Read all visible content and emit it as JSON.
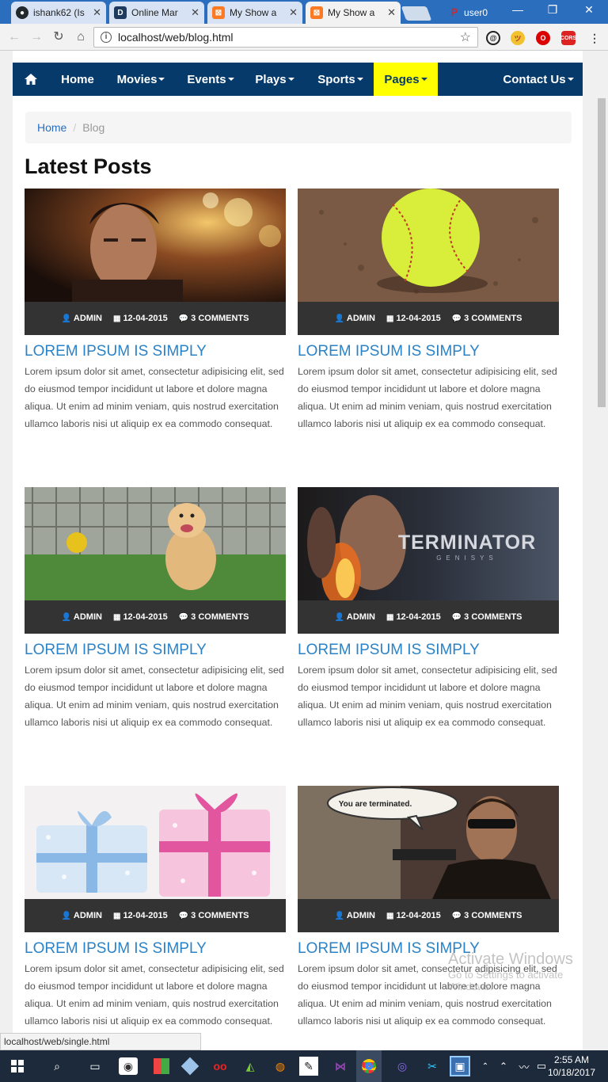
{
  "browser": {
    "tabs": [
      {
        "label": "ishank62 (Is",
        "icon": "github-icon",
        "icon_color": "#24292e",
        "icon_char": "●"
      },
      {
        "label": "Online Mar",
        "icon": "d-icon",
        "icon_color": "#1e3a5f",
        "icon_char": "D"
      },
      {
        "label": "My Show a",
        "icon": "xampp-icon",
        "icon_color": "#fb7a24",
        "icon_char": "⊠"
      },
      {
        "label": "My Show a",
        "icon": "xampp-icon",
        "icon_color": "#fb7a24",
        "icon_char": "⊠"
      }
    ],
    "user": "user0",
    "url": "localhost/web/blog.html",
    "status_url": "localhost/web/single.html"
  },
  "nav": {
    "items": [
      {
        "label": "Home"
      },
      {
        "label": "Movies"
      },
      {
        "label": "Events"
      },
      {
        "label": "Plays"
      },
      {
        "label": "Sports"
      },
      {
        "label": "Pages"
      },
      {
        "label": "Contact Us"
      }
    ]
  },
  "breadcrumb": {
    "home": "Home",
    "sep": "/",
    "current": "Blog"
  },
  "heading": "Latest Posts",
  "posts": [
    {
      "author": "ADMIN",
      "date": "12-04-2015",
      "comments": "3 COMMENTS",
      "title": "LOREM IPSUM IS SIMPLY",
      "text": "Lorem ipsum dolor sit amet, consectetur adipisicing elit, sed do eiusmod tempor incididunt ut labore et dolore magna aliqua. Ut enim ad minim veniam, quis nostrud exercitation ullamco laboris nisi ut aliquip ex ea commodo consequat.",
      "image": "man-portrait"
    },
    {
      "author": "ADMIN",
      "date": "12-04-2015",
      "comments": "3 COMMENTS",
      "title": "LOREM IPSUM IS SIMPLY",
      "text": "Lorem ipsum dolor sit amet, consectetur adipisicing elit, sed do eiusmod tempor incididunt ut labore et dolore magna aliqua. Ut enim ad minim veniam, quis nostrud exercitation ullamco laboris nisi ut aliquip ex ea commodo consequat.",
      "image": "softball"
    },
    {
      "author": "ADMIN",
      "date": "12-04-2015",
      "comments": "3 COMMENTS",
      "title": "LOREM IPSUM IS SIMPLY",
      "text": "Lorem ipsum dolor sit amet, consectetur adipisicing elit, sed do eiusmod tempor incididunt ut labore et dolore magna aliqua. Ut enim ad minim veniam, quis nostrud exercitation ullamco laboris nisi ut aliquip ex ea commodo consequat.",
      "image": "dog"
    },
    {
      "author": "ADMIN",
      "date": "12-04-2015",
      "comments": "3 COMMENTS",
      "title": "LOREM IPSUM IS SIMPLY",
      "text": "Lorem ipsum dolor sit amet, consectetur adipisicing elit, sed do eiusmod tempor incididunt ut labore et dolore magna aliqua. Ut enim ad minim veniam, quis nostrud exercitation ullamco laboris nisi ut aliquip ex ea commodo consequat.",
      "image": "terminator-poster",
      "image_text": "TERMINATOR",
      "image_subtext": "GENISYS"
    },
    {
      "author": "ADMIN",
      "date": "12-04-2015",
      "comments": "3 COMMENTS",
      "title": "LOREM IPSUM IS SIMPLY",
      "text": "Lorem ipsum dolor sit amet, consectetur adipisicing elit, sed do eiusmod tempor incididunt ut labore et dolore magna aliqua. Ut enim ad minim veniam, quis nostrud exercitation ullamco laboris nisi ut aliquip ex ea commodo consequat.",
      "image": "gifts"
    },
    {
      "author": "ADMIN",
      "date": "12-04-2015",
      "comments": "3 COMMENTS",
      "title": "LOREM IPSUM IS SIMPLY",
      "text": "Lorem ipsum dolor sit amet, consectetur adipisicing elit, sed do eiusmod tempor incididunt ut labore et dolore magna aliqua. Ut enim ad minim veniam, quis nostrud exercitation ullamco laboris nisi ut aliquip ex ea commodo consequat.",
      "image": "terminator-meme",
      "image_text": "You are terminated."
    }
  ],
  "watermark": {
    "line1": "Activate Windows",
    "line2": "Go to Settings to activate Windows."
  },
  "clock": {
    "time": "2:55 AM",
    "date": "10/18/2017"
  },
  "colors": {
    "nav_bg": "#053a6b",
    "nav_active": "#ffff00",
    "link": "#2a82c7",
    "meta_bg": "#333333"
  }
}
